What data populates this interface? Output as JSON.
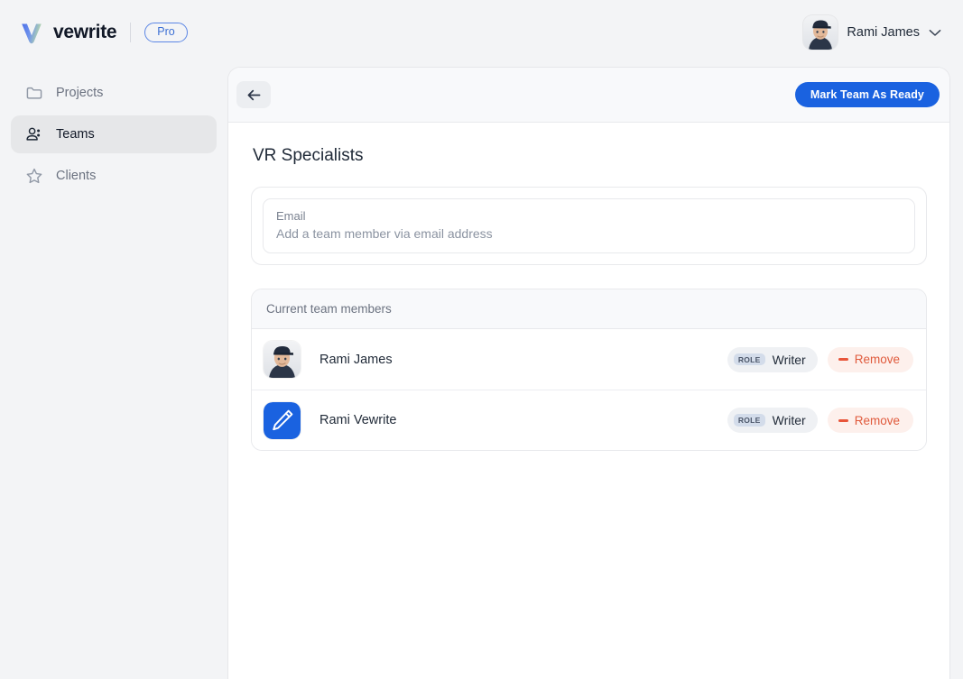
{
  "brand": {
    "name": "vewrite",
    "plan_badge": "Pro",
    "logo_icon": "v-logo-icon",
    "logo_gradient_from": "#3f6fe4",
    "logo_gradient_to": "#b9dba6"
  },
  "header": {
    "user_name": "Rami James",
    "avatar_icon": "user-photo-avatar",
    "chevron_icon": "chevron-down-icon"
  },
  "sidebar": {
    "items": [
      {
        "label": "Projects",
        "icon": "folder-icon",
        "active": false
      },
      {
        "label": "Teams",
        "icon": "users-icon",
        "active": true
      },
      {
        "label": "Clients",
        "icon": "star-icon",
        "active": false
      }
    ]
  },
  "toolbar": {
    "back_icon": "arrow-left-icon",
    "primary_label": "Mark Team As Ready",
    "primary_color": "#1a62e0"
  },
  "main": {
    "title": "VR Specialists",
    "email_field": {
      "label": "Email",
      "placeholder": "Add a team member via email address",
      "value": ""
    },
    "members_section": {
      "header": "Current team members",
      "members": [
        {
          "name": "Rami James",
          "avatar_icon": "user-photo-avatar",
          "role_tag": "ROLE",
          "role": "Writer",
          "remove_label": "Remove",
          "remove_icon": "minus-icon"
        },
        {
          "name": "Rami Vewrite",
          "avatar_icon": "pencil-avatar-icon",
          "role_tag": "ROLE",
          "role": "Writer",
          "remove_label": "Remove",
          "remove_icon": "minus-icon"
        }
      ]
    }
  },
  "colors": {
    "page_bg": "#f3f4f6",
    "panel_bg": "#ffffff",
    "accent_blue": "#1a62e0",
    "danger": "#e05a3c",
    "muted_text": "#6b7280"
  }
}
